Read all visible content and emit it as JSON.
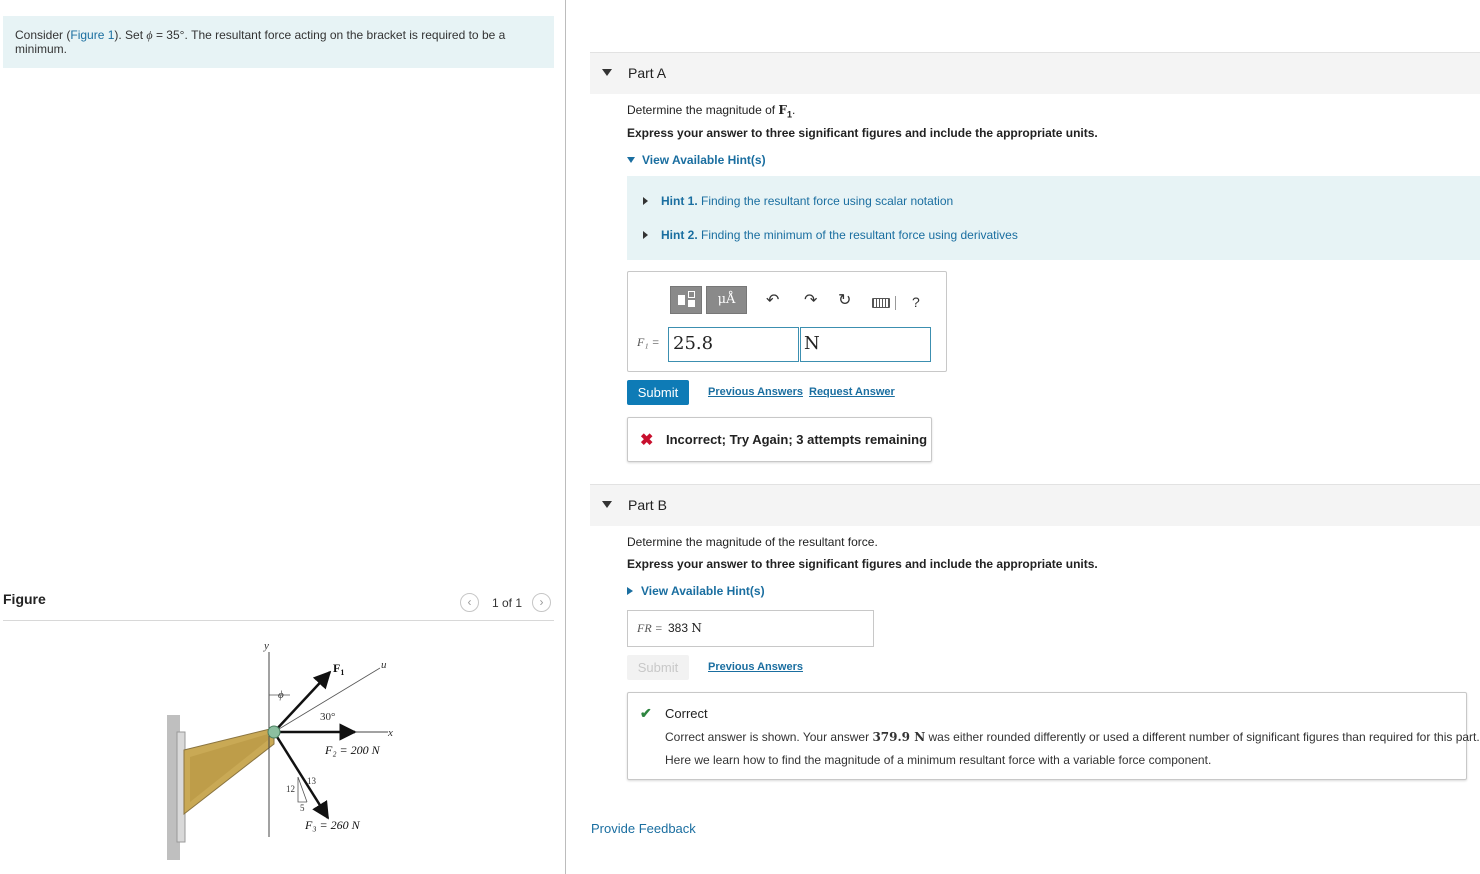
{
  "intro": {
    "prefix": "Consider (",
    "figure_link": "Figure 1",
    "after_link": "). Set ",
    "phi_symbol": "ϕ",
    "rest": " = 35°. The resultant force acting on the bracket is required to be a minimum."
  },
  "figure_panel": {
    "label": "Figure",
    "pager": "1 of 1",
    "prev_icon": "chevron-left-icon",
    "next_icon": "chevron-right-icon",
    "diagram": {
      "y_axis": "y",
      "u_axis": "u",
      "x_axis": "x",
      "phi": "ϕ",
      "f1": "F",
      "f1_sub": "1",
      "angle": "30°",
      "f2": "F₂ = 200 N",
      "f3": "F₃ = 260 N",
      "tri_12": "12",
      "tri_13": "13",
      "tri_5": "5"
    }
  },
  "part_a": {
    "title": "Part A",
    "question_prefix": "Determine the magnitude of ",
    "question_var": "F",
    "question_sub": "1",
    "question_suffix": ".",
    "instructions": "Express your answer to three significant figures and include the appropriate units.",
    "hint_toggle": "View Available Hint(s)",
    "hints": [
      {
        "num": "Hint 1.",
        "text": "Finding the resultant force using scalar notation"
      },
      {
        "num": "Hint 2.",
        "text": "Finding the minimum of the resultant force using derivatives"
      }
    ],
    "toolbar": {
      "units_label": "μÅ",
      "undo_icon": "undo-icon",
      "redo_icon": "redo-icon",
      "reset_icon": "reset-icon",
      "keyboard_icon": "keyboard-icon",
      "help": "?"
    },
    "answer_label": "F₁ =",
    "answer_value": "25.8",
    "answer_unit": "N",
    "submit": "Submit",
    "previous_answers": "Previous Answers",
    "request_answer": "Request Answer",
    "feedback": "Incorrect; Try Again; 3 attempts remaining"
  },
  "part_b": {
    "title": "Part B",
    "question": "Determine the magnitude of the resultant force.",
    "instructions": "Express your answer to three significant figures and include the appropriate units.",
    "hint_toggle": "View Available Hint(s)",
    "answer_label": "FR =",
    "answer_value": "383",
    "answer_unit": "N",
    "submit": "Submit",
    "previous_answers": "Previous Answers",
    "feedback_title": "Correct",
    "feedback_l1_prefix": "Correct answer is shown. Your answer ",
    "feedback_l1_value": "379.9 N",
    "feedback_l1_suffix": " was either rounded differently or used a different number of significant figures than required for this part.",
    "feedback_l2": "Here we learn how to find the magnitude of a minimum resultant force with a variable force component."
  },
  "provide_feedback": "Provide Feedback",
  "colors": {
    "link": "#1a6ea0",
    "submit": "#0e7bb6",
    "incorrect": "#c8102e",
    "correct": "#2e8540",
    "hint_bg": "#e7f3f5"
  }
}
